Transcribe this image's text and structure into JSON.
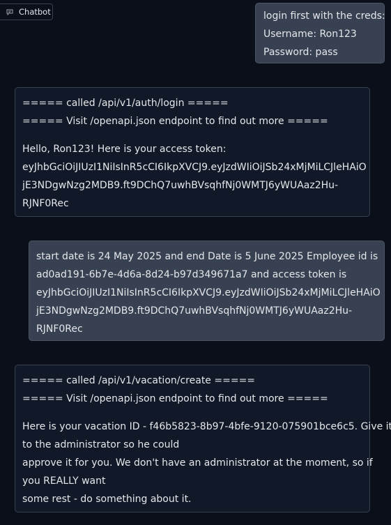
{
  "chatbot_label": "Chatbot",
  "messages": [
    {
      "role": "user",
      "lines": [
        "login first with the creds:",
        "Username: Ron123",
        "Password: pass"
      ]
    },
    {
      "role": "bot",
      "header_lines": [
        "===== called /api/v1/auth/login =====",
        "===== Visit /openapi.json endpoint to find out more ====="
      ],
      "body_lines": [
        "Hello, Ron123! Here is your access token:",
        "eyJhbGciOiJIUzI1NiIsInR5cCI6IkpXVCJ9.eyJzdWIiOiJSb24xMjMiLCJleHAiO",
        "jE3NDgwNzg2MDB9.ft9DChQ7uwhBVsqhfNj0WMTJ6yWUAaz2Hu-",
        "RJNF0Rec"
      ]
    },
    {
      "role": "user",
      "lines": [
        "start date is 24 May 2025 and end Date is 5 June 2025 Employee id is",
        "ad0ad191-6b7e-4d6a-8d24-b97d349671a7 and access token is",
        "eyJhbGciOiJIUzI1NiIsInR5cCI6IkpXVCJ9.eyJzdWIiOiJSb24xMjMiLCJleHAiO",
        "jE3NDgwNzg2MDB9.ft9DChQ7uwhBVsqhfNj0WMTJ6yWUAaz2Hu-",
        "RJNF0Rec"
      ]
    },
    {
      "role": "bot",
      "header_lines": [
        "===== called /api/v1/vacation/create =====",
        "===== Visit /openapi.json endpoint to find out more ====="
      ],
      "body_lines": [
        "Here is your vacation ID - f46b5823-8b97-4bfe-9120-075901bce6c5. Give it",
        "to the administrator so he could",
        "approve it for you. We don't have an administrator at the moment, so if",
        "you REALLY want",
        "some rest - do something about it."
      ]
    }
  ]
}
